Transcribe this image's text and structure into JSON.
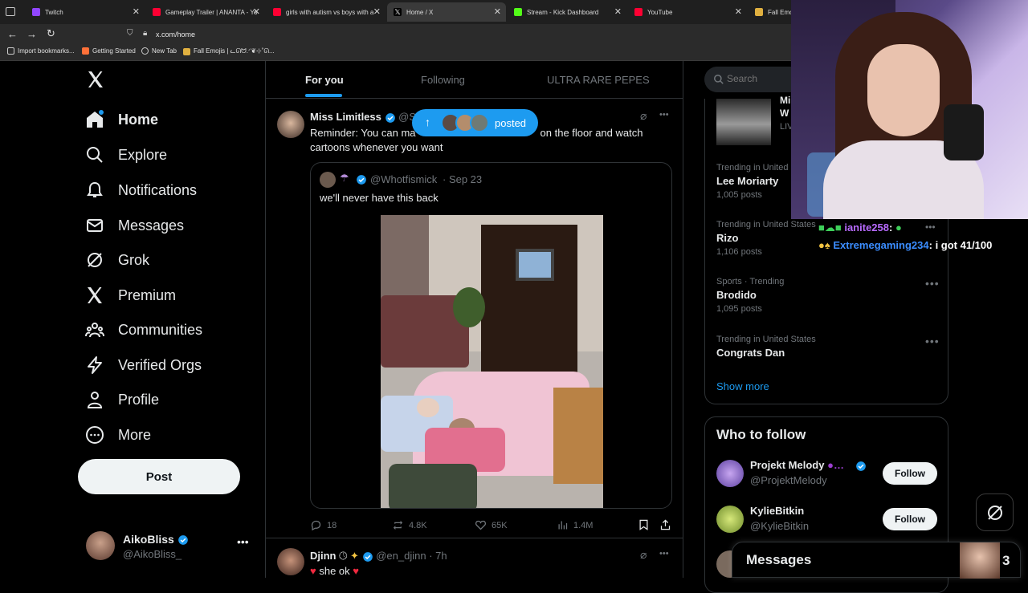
{
  "browser": {
    "tabs": [
      {
        "label": "Twitch",
        "color": "#9146ff"
      },
      {
        "label": "Gameplay Trailer | ANANTA - Yo",
        "color": "#ff0033"
      },
      {
        "label": "girls with autism vs boys with a",
        "color": "#ff0033"
      },
      {
        "label": "Home / X",
        "color": "#000000"
      },
      {
        "label": "Stream - Kick Dashboard",
        "color": "#53fc18"
      },
      {
        "label": "YouTube",
        "color": "#ff0033"
      },
      {
        "label": "Fall Emoji",
        "color": "#e0b040"
      }
    ],
    "url": "x.com/home",
    "bookmarks": [
      "Import bookmarks...",
      "Getting Started",
      "New Tab",
      "Fall Emojis | ᓚᘏᗢ.ᐟ❦⊹˚ᘏ..."
    ]
  },
  "nav": {
    "items": [
      "Home",
      "Explore",
      "Notifications",
      "Messages",
      "Grok",
      "Premium",
      "Communities",
      "Verified Orgs",
      "Profile",
      "More"
    ],
    "post_label": "Post",
    "account_name": "AikoBliss",
    "account_handle": "@AikoBliss_"
  },
  "feed": {
    "tabs": [
      "For you",
      "Following",
      "ULTRA RARE PEPES"
    ],
    "posted_pill": "posted",
    "tweet1": {
      "name": "Miss Limitless",
      "handle": "@S",
      "text_a": "Reminder: You can ma",
      "text_b": "on the floor and watch",
      "text_c": "cartoons whenever you want",
      "quote_handle": "@Whotfismick",
      "quote_date": "· Sep 23",
      "quote_text": "we'll never have this back",
      "replies": "18",
      "reposts": "4.8K",
      "likes": "65K",
      "views": "1.4M"
    },
    "tweet2": {
      "name": "Djinn",
      "handle": "@en_djinn",
      "time": "· 7h",
      "text": "she ok"
    }
  },
  "search": {
    "placeholder": "Search"
  },
  "trends": [
    {
      "category": "Trending in United States",
      "name": "Lee Moriarty",
      "count": "1,005 posts"
    },
    {
      "category": "Trending in United States",
      "name": "Rizo",
      "count": "1,106 posts"
    },
    {
      "category": "Sports · Trending",
      "name": "Brodido",
      "count": "1,095 posts"
    },
    {
      "category": "Trending in United States",
      "name": "Congrats Dan",
      "count": ""
    }
  ],
  "trend_partial": {
    "line1": "Mi",
    "line2": "W",
    "line3": "LIV"
  },
  "show_more": "Show more",
  "who_to_follow": {
    "title": "Who to follow",
    "users": [
      {
        "name": "Projekt Melody",
        "handle": "@ProjektMelody"
      },
      {
        "name": "KylieBitkin",
        "handle": "@KylieBitkin"
      }
    ],
    "follow_label": "Follow"
  },
  "messages_drawer": {
    "title": "Messages",
    "count": "3"
  },
  "chat_overlay": [
    {
      "user": "ianite258",
      "text": ":"
    },
    {
      "user": "Extremegaming234",
      "text": ": i got 41/100"
    }
  ],
  "colors": {
    "accent": "#1d9bf0",
    "background": "#000000",
    "chat_user": "#b86bff",
    "chat_user2": "#3b8dff"
  }
}
